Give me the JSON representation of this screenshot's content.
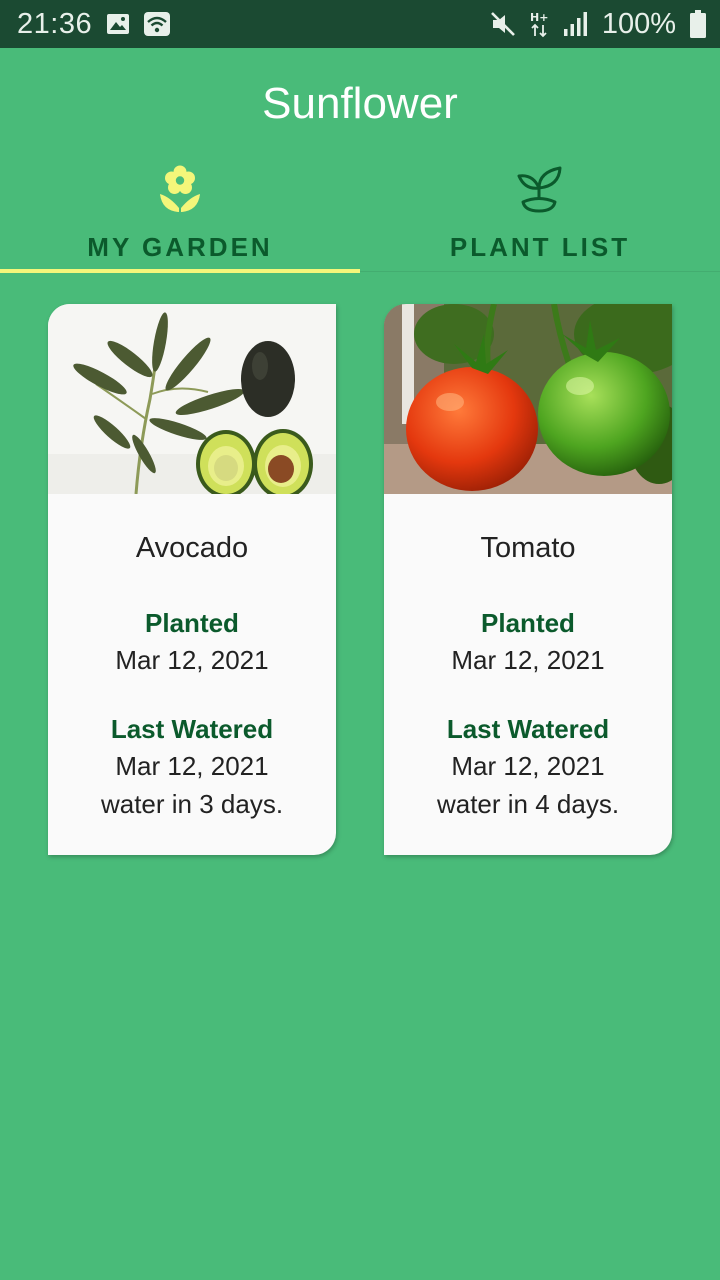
{
  "status_bar": {
    "time": "21:36",
    "battery": "100%",
    "icons": [
      "image-icon",
      "wifi-icon",
      "mute-icon",
      "hplus-icon",
      "signal-icon",
      "battery-icon"
    ]
  },
  "app": {
    "title": "Sunflower"
  },
  "tabs": [
    {
      "label": "MY GARDEN",
      "icon": "flower-icon",
      "selected": true
    },
    {
      "label": "PLANT LIST",
      "icon": "sprout-icon",
      "selected": false
    }
  ],
  "colors": {
    "background": "#49bb79",
    "status_bar": "#1b4a32",
    "accent": "#f4f67a",
    "label_green": "#0b5a2c"
  },
  "garden": [
    {
      "name": "Avocado",
      "planted_label": "Planted",
      "planted_date": "Mar 12, 2021",
      "watered_label": "Last Watered",
      "watered_date": "Mar 12, 2021",
      "water_note": "water in 3 days."
    },
    {
      "name": "Tomato",
      "planted_label": "Planted",
      "planted_date": "Mar 12, 2021",
      "watered_label": "Last Watered",
      "watered_date": "Mar 12, 2021",
      "water_note": "water in 4 days."
    }
  ]
}
